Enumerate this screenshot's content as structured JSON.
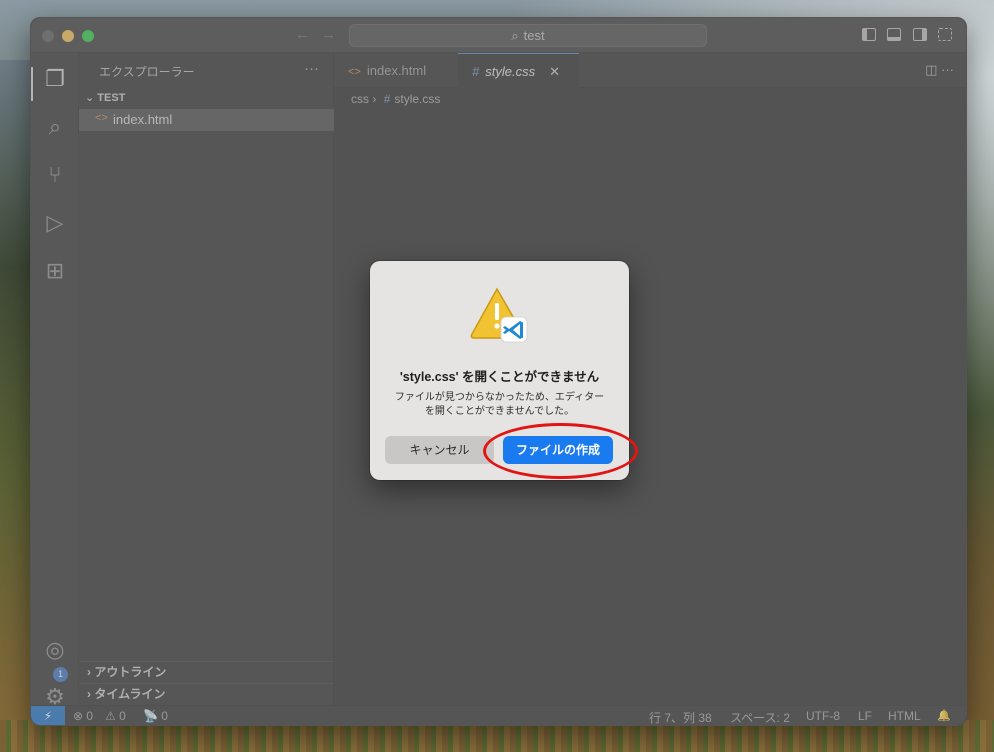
{
  "window": {
    "search": "test",
    "nav_back": "←",
    "nav_forward": "→"
  },
  "sidebar": {
    "title": "エクスプローラー",
    "more": "···",
    "section": "TEST",
    "file": "index.html",
    "file_icon": "<>",
    "outline": "アウトライン",
    "timeline": "タイムライン"
  },
  "tabs": [
    {
      "label": "index.html",
      "icon": "<>"
    },
    {
      "label": "style.css",
      "icon": "#",
      "close": "✕"
    }
  ],
  "tab_actions": "◫  ···",
  "breadcrumb": {
    "folder": "css",
    "sep": "›",
    "icon": "#",
    "file": "style.css"
  },
  "activity_badge": "1",
  "dialog": {
    "title": "'style.css' を開くことができません",
    "message_line1": "ファイルが見つからなかったため、エディター",
    "message_line2": "を開くことができませんでした。",
    "cancel": "キャンセル",
    "create": "ファイルの作成"
  },
  "status": {
    "remote": "⚡",
    "errors": "⊗ 0",
    "warnings": "⚠ 0",
    "ports": "📡 0",
    "position": "行 7、列 38",
    "spaces": "スペース: 2",
    "encoding": "UTF-8",
    "eol": "LF",
    "language": "HTML",
    "bell": "🔔"
  },
  "colors": {
    "accent": "#1a7bf0",
    "annotation": "#e31414",
    "warning": "#f1c232"
  }
}
